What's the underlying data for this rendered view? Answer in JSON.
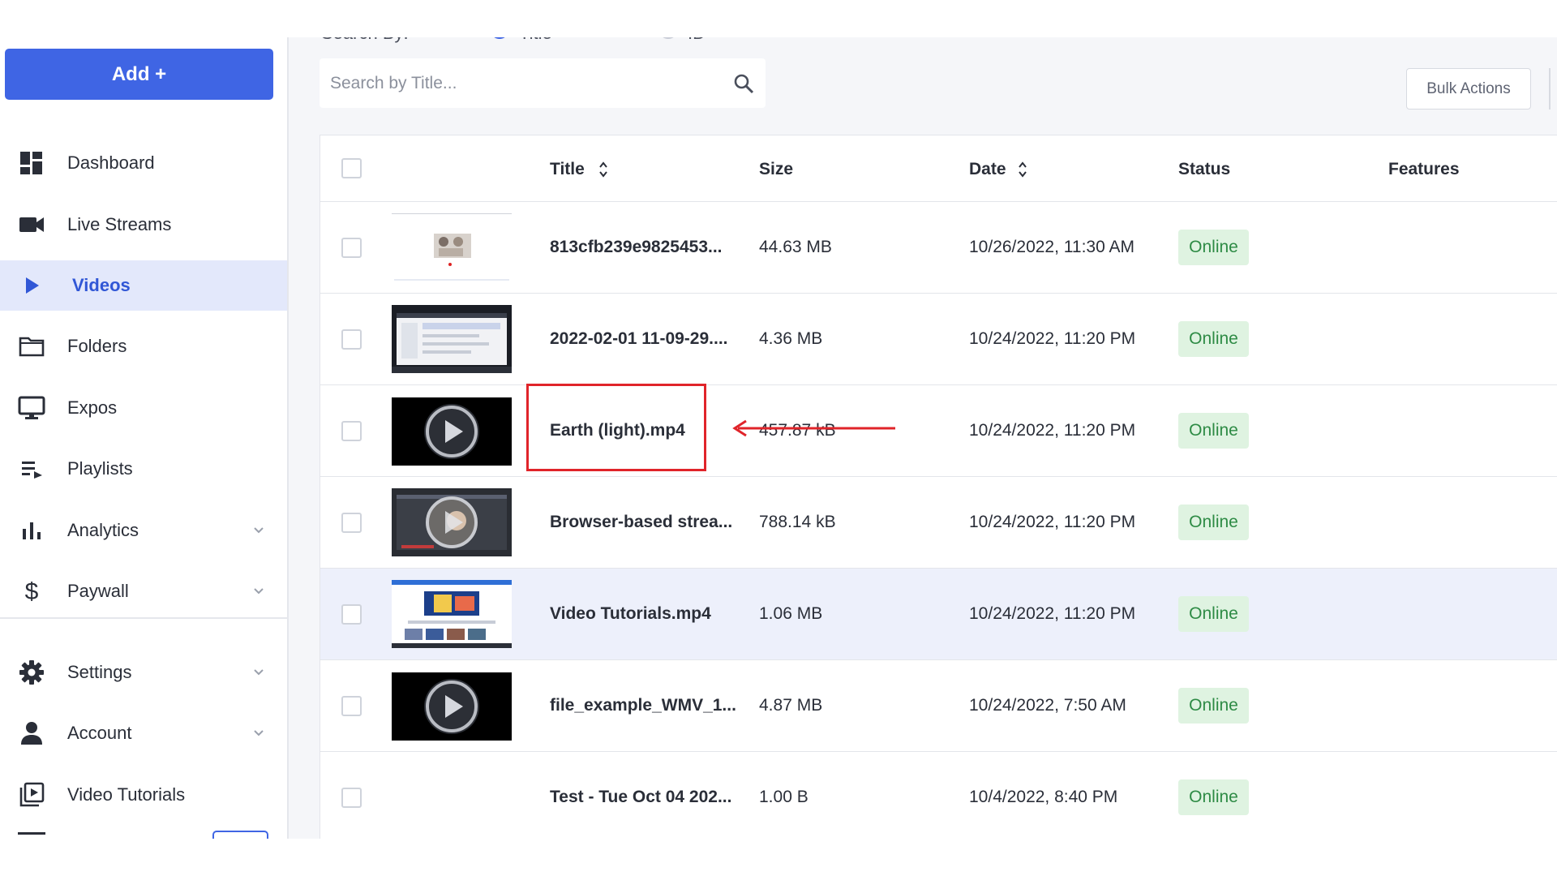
{
  "sidebar": {
    "add_label": "Add +",
    "items": [
      {
        "label": "Dashboard",
        "icon": "dashboard-icon"
      },
      {
        "label": "Live Streams",
        "icon": "video-camera-icon"
      },
      {
        "label": "Videos",
        "icon": "play-icon",
        "active": true
      },
      {
        "label": "Folders",
        "icon": "folder-icon"
      },
      {
        "label": "Expos",
        "icon": "monitor-icon"
      },
      {
        "label": "Playlists",
        "icon": "playlist-icon"
      },
      {
        "label": "Analytics",
        "icon": "bar-chart-icon",
        "expandable": true
      },
      {
        "label": "Paywall",
        "icon": "dollar-icon",
        "expandable": true
      },
      {
        "label": "Settings",
        "icon": "gear-icon",
        "expandable": true
      },
      {
        "label": "Account",
        "icon": "person-icon",
        "expandable": true
      },
      {
        "label": "Video Tutorials",
        "icon": "video-library-icon"
      }
    ]
  },
  "search": {
    "search_by_label": "Search By:",
    "options": [
      "Title",
      "ID"
    ],
    "selected_option": "Title",
    "placeholder": "Search by Title...",
    "value": ""
  },
  "toolbar": {
    "bulk_actions_label": "Bulk Actions"
  },
  "table": {
    "columns": [
      "Title",
      "Size",
      "Date",
      "Status",
      "Features"
    ],
    "rows": [
      {
        "title": "813cfb239e9825453...",
        "size": "44.63 MB",
        "date": "10/26/2022, 11:30 AM",
        "status": "Online",
        "thumb": "webpage-light"
      },
      {
        "title": "2022-02-01 11-09-29....",
        "size": "4.36 MB",
        "date": "10/24/2022, 11:20 PM",
        "status": "Online",
        "thumb": "screen-dark"
      },
      {
        "title": "Earth (light).mp4",
        "size": "457.87 kB",
        "date": "10/24/2022, 11:20 PM",
        "status": "Online",
        "thumb": "play-placeholder"
      },
      {
        "title": "Browser-based strea...",
        "size": "788.14 kB",
        "date": "10/24/2022, 11:20 PM",
        "status": "Online",
        "thumb": "webcam-play"
      },
      {
        "title": "Video Tutorials.mp4",
        "size": "1.06 MB",
        "date": "10/24/2022, 11:20 PM",
        "status": "Online",
        "thumb": "webpage-blue",
        "highlighted": true
      },
      {
        "title": "file_example_WMV_1...",
        "size": "4.87 MB",
        "date": "10/24/2022, 7:50 AM",
        "status": "Online",
        "thumb": "play-placeholder"
      },
      {
        "title": "Test - Tue Oct 04 202...",
        "size": "1.00 B",
        "date": "10/4/2022, 8:40 PM",
        "status": "Online",
        "thumb": "none"
      }
    ]
  },
  "annotation": {
    "target": "Earth (light).mp4",
    "color": "#e0242a"
  },
  "colors": {
    "accent": "#3f65e4",
    "status_bg": "#dff3e1",
    "status_text": "#2e8b45",
    "highlight_row": "#edf0fb"
  }
}
